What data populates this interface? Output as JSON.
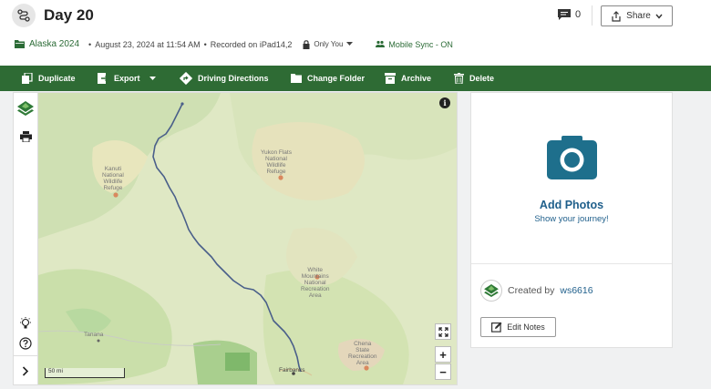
{
  "header": {
    "title": "Day 20",
    "message_count": "0",
    "share_label": "Share"
  },
  "meta": {
    "folder": "Alaska 2024",
    "date": "August 23, 2024 at 11:54 AM",
    "recorded_on": "Recorded on iPad14,2",
    "privacy": "Only You",
    "sync": "Mobile Sync - ON"
  },
  "toolbar": {
    "duplicate": "Duplicate",
    "export": "Export",
    "directions": "Driving Directions",
    "change_folder": "Change Folder",
    "archive": "Archive",
    "delete": "Delete"
  },
  "map": {
    "labels": {
      "kanuti": "Kanuti\nNational\nWildlife\nRefuge",
      "yukon": "Yukon Flats\nNational\nWildlife\nRefuge",
      "white_mountains": "White\nMountains\nNational\nRecreation\nArea",
      "chena": "Chena\nState\nRecreation\nArea",
      "tanana": "Tanana",
      "fairbanks": "Fairbanks"
    },
    "scale": "50 mi",
    "info": "i",
    "zoom_in": "+",
    "zoom_out": "−"
  },
  "panel": {
    "add_photos": "Add Photos",
    "show_journey": "Show your journey!",
    "created_by": "Created by",
    "username": "ws6616",
    "edit_notes": "Edit Notes"
  },
  "colors": {
    "brand_green": "#2e6b34",
    "link_blue": "#1f5f8b",
    "camera_teal": "#1e6f8c",
    "track_line": "#4a5f8a"
  }
}
